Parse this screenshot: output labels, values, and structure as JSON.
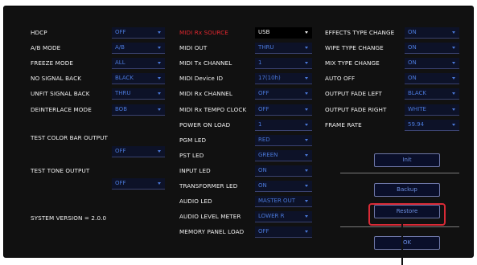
{
  "left": {
    "hdcp": {
      "label": "HDCP",
      "value": "OFF"
    },
    "ab_mode": {
      "label": "A/B MODE",
      "value": "A/B"
    },
    "freeze_mode": {
      "label": "FREEZE MODE",
      "value": "ALL"
    },
    "no_signal_back": {
      "label": "NO SIGNAL BACK",
      "value": "BLACK"
    },
    "unfit_signal_back": {
      "label": "UNFIT SIGNAL BACK",
      "value": "THRU"
    },
    "deinterlace_mode": {
      "label": "DEINTERLACE MODE",
      "value": "BOB"
    },
    "test_color_bar": {
      "label": "TEST COLOR BAR OUTPUT",
      "value": "OFF"
    },
    "test_tone": {
      "label": "TEST TONE OUTPUT",
      "value": "OFF"
    },
    "system_version": "SYSTEM VERSION = 2.0.0"
  },
  "middle": {
    "midi_rx_source": {
      "label": "MIDI Rx SOURCE",
      "value": "USB"
    },
    "midi_out": {
      "label": "MIDI OUT",
      "value": "THRU"
    },
    "midi_tx_channel": {
      "label": "MIDI Tx CHANNEL",
      "value": "1"
    },
    "midi_device_id": {
      "label": "MIDI Device ID",
      "value": "17(10h)"
    },
    "midi_rx_channel": {
      "label": "MIDI Rx CHANNEL",
      "value": "OFF"
    },
    "midi_rx_tempo_clock": {
      "label": "MIDI Rx TEMPO CLOCK",
      "value": "OFF"
    },
    "power_on_load": {
      "label": "POWER ON LOAD",
      "value": "1"
    },
    "pgm_led": {
      "label": "PGM LED",
      "value": "RED"
    },
    "pst_led": {
      "label": "PST LED",
      "value": "GREEN"
    },
    "input_led": {
      "label": "INPUT LED",
      "value": "ON"
    },
    "transformer_led": {
      "label": "TRANSFORMER LED",
      "value": "ON"
    },
    "audio_led": {
      "label": "AUDIO LED",
      "value": "MASTER OUT"
    },
    "audio_level_meter": {
      "label": "AUDIO LEVEL METER",
      "value": "LOWER R"
    },
    "memory_panel_load": {
      "label": "MEMORY PANEL LOAD",
      "value": "OFF"
    }
  },
  "right": {
    "effects_type_change": {
      "label": "EFFECTS TYPE CHANGE",
      "value": "ON"
    },
    "wipe_type_change": {
      "label": "WIPE TYPE CHANGE",
      "value": "ON"
    },
    "mix_type_change": {
      "label": "MIX TYPE CHANGE",
      "value": "ON"
    },
    "auto_off": {
      "label": "AUTO OFF",
      "value": "ON"
    },
    "output_fade_left": {
      "label": "OUTPUT FADE LEFT",
      "value": "BLACK"
    },
    "output_fade_right": {
      "label": "OUTPUT FADE RIGHT",
      "value": "WHITE"
    },
    "frame_rate": {
      "label": "FRAME RATE",
      "value": "59.94"
    }
  },
  "buttons": {
    "init": "Init",
    "backup": "Backup",
    "restore": "Restore",
    "ok": "OK"
  },
  "colors": {
    "highlight_label": "#e0262e",
    "callout": "#d92a36",
    "dropdown_text": "#4a78d8",
    "panel_bg": "#111111"
  }
}
